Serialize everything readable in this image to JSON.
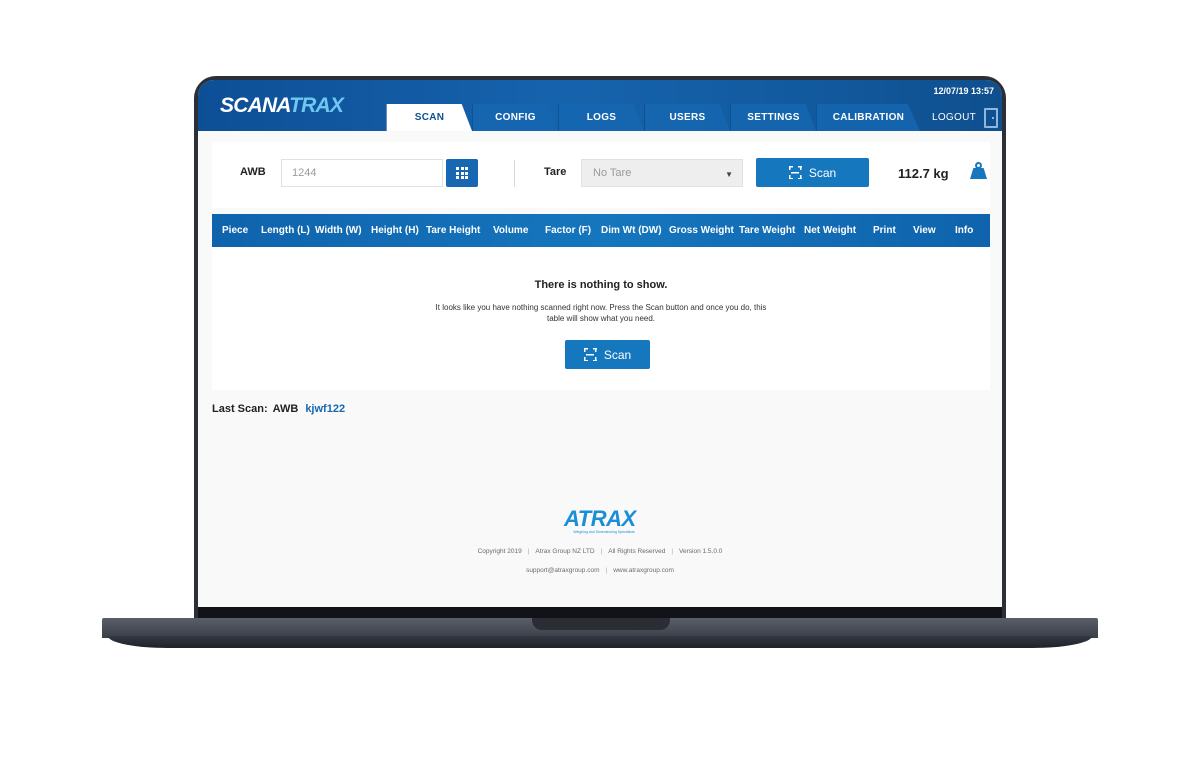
{
  "header": {
    "logo_main": "SCANA",
    "logo_accent": "TRAX",
    "datetime": "12/07/19 13:57",
    "tabs": [
      {
        "label": "SCAN",
        "active": true
      },
      {
        "label": "CONFIG",
        "active": false
      },
      {
        "label": "LOGS",
        "active": false
      },
      {
        "label": "USERS",
        "active": false
      },
      {
        "label": "SETTINGS",
        "active": false
      },
      {
        "label": "CALIBRATION",
        "active": false
      }
    ],
    "logout_label": "LOGOUT"
  },
  "scanbar": {
    "awb_label": "AWB",
    "awb_value": "1244",
    "tare_label": "Tare",
    "tare_value": "No Tare",
    "scan_label": "Scan",
    "weight": "112.7 kg"
  },
  "table": {
    "columns": [
      "Piece",
      "Length (L)",
      "Width (W)",
      "Height (H)",
      "Tare Height",
      "Volume",
      "Factor (F)",
      "Dim Wt (DW)",
      "Gross Weight",
      "Tare Weight",
      "Net Weight",
      "Print",
      "View",
      "Info"
    ],
    "empty_title": "There is nothing to show.",
    "empty_text": "It looks like you have nothing scanned right now.  Press the Scan button and once you do, this table will show what you need.",
    "scan_label": "Scan"
  },
  "last_scan": {
    "label": "Last Scan:",
    "type": "AWB",
    "value": "kjwf122"
  },
  "footer": {
    "brand": "ATRAX",
    "tagline": "Weighing and Dimensioning Specialists",
    "copyright": "Copyright 2019",
    "company": "Atrax Group NZ LTD",
    "rights": "All Rights Reserved",
    "version": "Version 1.5.0.0",
    "email": "support@atraxgroup.com",
    "website": "www.atraxgroup.com"
  },
  "colors": {
    "header_blue": "#0d4f96",
    "accent_blue": "#1577bd",
    "link_blue": "#1767b3",
    "logo_accent": "#6ec7f0"
  }
}
